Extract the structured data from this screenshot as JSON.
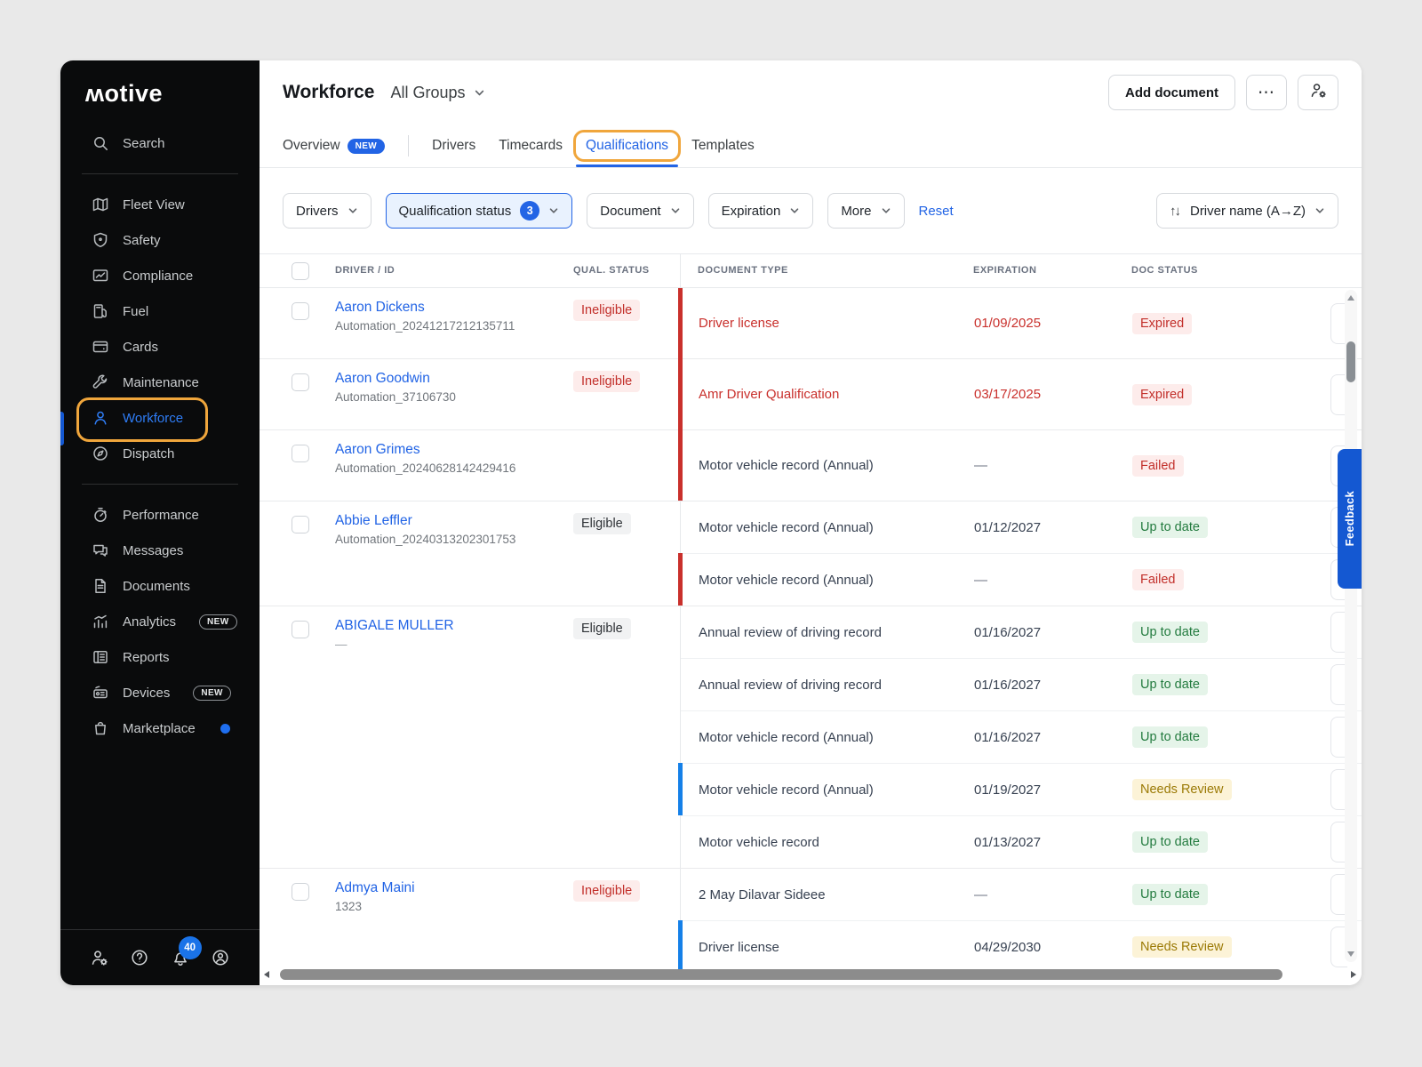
{
  "colors": {
    "accent_blue": "#2264e5",
    "alert_red": "#c9302c",
    "ok_green": "#237b3f",
    "warn_amber": "#9b7a06",
    "highlight_orange": "#f0a63c",
    "feedback_blue": "#1458d2"
  },
  "sidebar": {
    "logo_text": "ʍotive",
    "search_label": "Search",
    "primary_items": [
      {
        "label": "Fleet View",
        "icon": "map-icon"
      },
      {
        "label": "Safety",
        "icon": "shield-icon"
      },
      {
        "label": "Compliance",
        "icon": "monitor-chart-icon"
      },
      {
        "label": "Fuel",
        "icon": "fuel-pump-icon"
      },
      {
        "label": "Cards",
        "icon": "credit-card-icon"
      },
      {
        "label": "Maintenance",
        "icon": "wrench-icon"
      },
      {
        "label": "Workforce",
        "icon": "person-icon",
        "active": true
      },
      {
        "label": "Dispatch",
        "icon": "compass-icon"
      }
    ],
    "secondary_items": [
      {
        "label": "Performance",
        "icon": "stopwatch-icon"
      },
      {
        "label": "Messages",
        "icon": "chat-icon"
      },
      {
        "label": "Documents",
        "icon": "document-icon"
      },
      {
        "label": "Analytics",
        "icon": "analytics-icon",
        "badge": "NEW"
      },
      {
        "label": "Reports",
        "icon": "report-icon"
      },
      {
        "label": "Devices",
        "icon": "device-icon",
        "badge": "NEW"
      },
      {
        "label": "Marketplace",
        "icon": "shopping-bag-icon",
        "dot": true
      }
    ],
    "notification_count": "40"
  },
  "header": {
    "title": "Workforce",
    "group_selector": "All Groups",
    "add_document_label": "Add document",
    "more_label": "⋯"
  },
  "tabs": [
    {
      "label": "Overview",
      "badge": "NEW"
    },
    {
      "label": "Drivers"
    },
    {
      "label": "Timecards"
    },
    {
      "label": "Qualifications",
      "active": true
    },
    {
      "label": "Templates"
    }
  ],
  "filters": {
    "drivers_label": "Drivers",
    "qualification_status_label": "Qualification status",
    "qualification_status_count": "3",
    "document_label": "Document",
    "expiration_label": "Expiration",
    "more_label": "More",
    "reset_label": "Reset",
    "sort_glyph": "↑↓",
    "sort_label": "Driver name (A→Z)"
  },
  "table": {
    "columns": [
      "DRIVER / ID",
      "QUAL. STATUS",
      "DOCUMENT TYPE",
      "EXPIRATION",
      "DOC STATUS"
    ],
    "rows": [
      {
        "name": "Aaron Dickens",
        "id": "Automation_20241217212135711",
        "qual_status": "Ineligible",
        "qual_variant": "b-red",
        "docs": [
          {
            "type": "Driver license",
            "alert": true,
            "expiration": "01/09/2025",
            "status": "Expired",
            "status_variant": "b-red",
            "border": "red"
          }
        ]
      },
      {
        "name": "Aaron Goodwin",
        "id": "Automation_37106730",
        "qual_status": "Ineligible",
        "qual_variant": "b-red",
        "docs": [
          {
            "type": "Amr Driver Qualification",
            "alert": true,
            "expiration": "03/17/2025",
            "status": "Expired",
            "status_variant": "b-red",
            "border": "red"
          }
        ]
      },
      {
        "name": "Aaron Grimes",
        "id": "Automation_20240628142429416",
        "qual_status": "",
        "qual_variant": "",
        "docs": [
          {
            "type": "Motor vehicle record (Annual)",
            "expiration": "—",
            "status": "Failed",
            "status_variant": "b-red",
            "border": "red"
          }
        ]
      },
      {
        "name": "Abbie Leffler",
        "id": "Automation_20240313202301753",
        "qual_status": "Eligible",
        "qual_variant": "b-gray",
        "docs": [
          {
            "type": "Motor vehicle record (Annual)",
            "expiration": "01/12/2027",
            "status": "Up to date",
            "status_variant": "b-green"
          },
          {
            "type": "Motor vehicle record (Annual)",
            "expiration": "—",
            "status": "Failed",
            "status_variant": "b-red",
            "border": "red"
          }
        ]
      },
      {
        "name": "ABIGALE MULLER",
        "id": "—",
        "id_muted": true,
        "qual_status": "Eligible",
        "qual_variant": "b-gray",
        "docs": [
          {
            "type": "Annual review of driving record",
            "expiration": "01/16/2027",
            "status": "Up to date",
            "status_variant": "b-green"
          },
          {
            "type": "Annual review of driving record",
            "expiration": "01/16/2027",
            "status": "Up to date",
            "status_variant": "b-green"
          },
          {
            "type": "Motor vehicle record (Annual)",
            "expiration": "01/16/2027",
            "status": "Up to date",
            "status_variant": "b-green"
          },
          {
            "type": "Motor vehicle record (Annual)",
            "expiration": "01/19/2027",
            "status": "Needs Review",
            "status_variant": "b-amber",
            "border": "blue"
          },
          {
            "type": "Motor vehicle record",
            "expiration": "01/13/2027",
            "status": "Up to date",
            "status_variant": "b-green"
          }
        ]
      },
      {
        "name": "Admya Maini",
        "id": "1323",
        "qual_status": "Ineligible",
        "qual_variant": "b-red",
        "docs": [
          {
            "type": "2 May Dilavar Sideee",
            "expiration": "—",
            "status": "Up to date",
            "status_variant": "b-green"
          },
          {
            "type": "Driver license",
            "expiration": "04/29/2030",
            "status": "Needs Review",
            "status_variant": "b-amber",
            "border": "blue"
          }
        ]
      }
    ]
  },
  "feedback_label": "Feedback"
}
